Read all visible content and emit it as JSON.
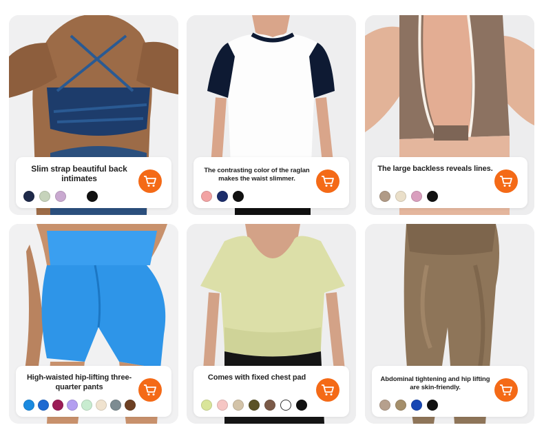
{
  "products": [
    {
      "title": "Slim strap beautiful back intimates",
      "photo_icon": "back-strap-bra-photo",
      "swatches": [
        "#1f2a4a",
        "#c6d3bb",
        "#c9a9d0",
        "#ffffff",
        "#111111"
      ]
    },
    {
      "title": "The contrasting color of the raglan makes the waist slimmer.",
      "photo_icon": "raglan-tee-photo",
      "swatches": [
        "#f2a3a3",
        "#1c2d6b",
        "#111111"
      ]
    },
    {
      "title": "The large backless reveals lines.",
      "photo_icon": "backless-tank-photo",
      "swatches": [
        "#b09a86",
        "#eadfc9",
        "#d99fbe",
        "#111111"
      ]
    },
    {
      "title": "High-waisted hip-lifting three-quarter pants",
      "photo_icon": "shorts-photo",
      "swatches": [
        "#1a8ae0",
        "#1f6ad1",
        "#9b1c56",
        "#b39ef0",
        "#c8ecd0",
        "#f0e3cf",
        "#7d8c92",
        "#6e4023"
      ]
    },
    {
      "title": "Comes with fixed chest pad",
      "photo_icon": "scoop-tee-photo",
      "swatches": [
        "#d9e59a",
        "#f6c6c4",
        "#d3c3a8",
        "#5b5225",
        "#7b5a48",
        "#ffffff",
        "#111111"
      ]
    },
    {
      "title": "Abdominal tightening and hip lifting are skin-friendly.",
      "photo_icon": "leggings-photo",
      "swatches": [
        "#b6a08d",
        "#a58f6b",
        "#1847b3",
        "#111111"
      ]
    }
  ],
  "accent_color": "#f46a17",
  "cart_icon": "shopping-cart-icon"
}
